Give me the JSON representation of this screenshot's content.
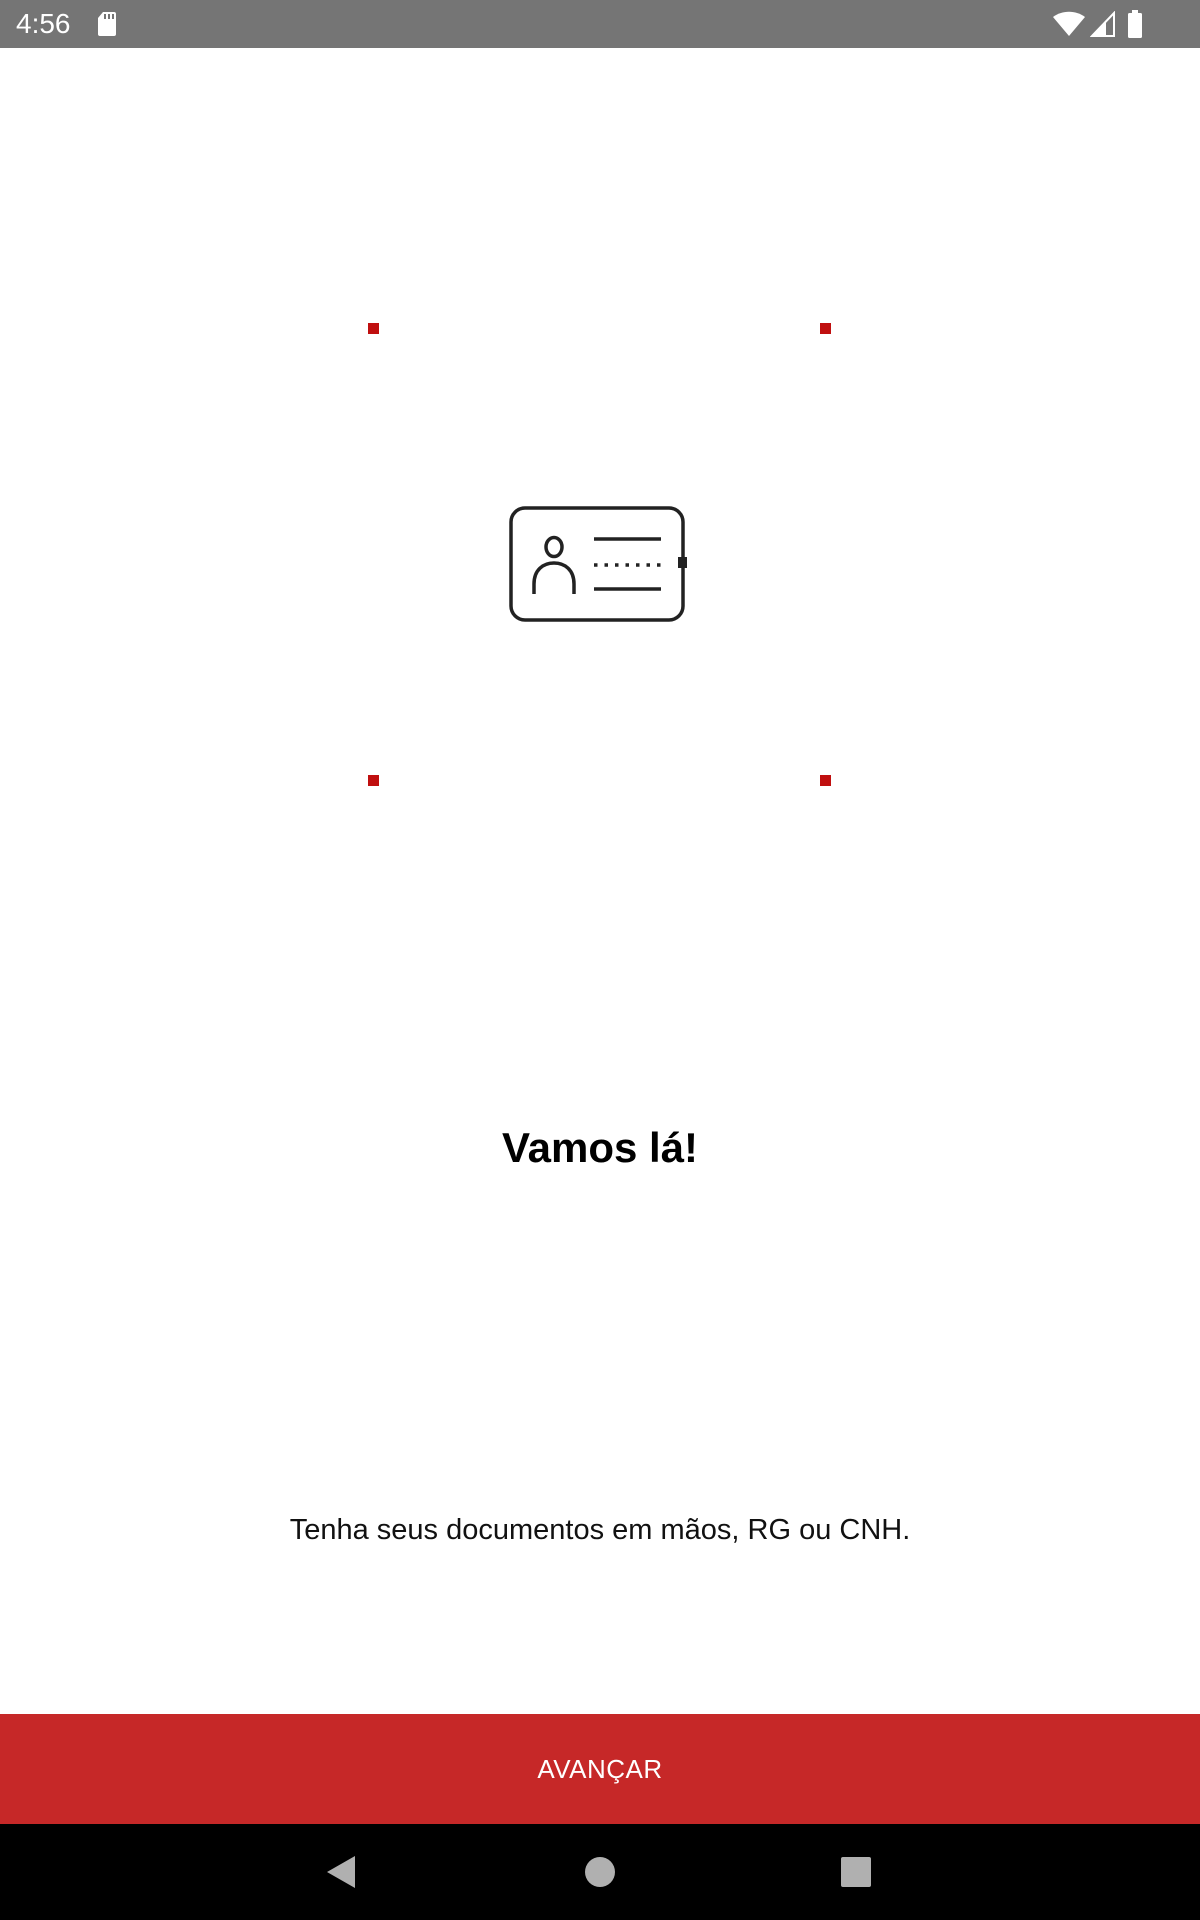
{
  "status_bar": {
    "time": "4:56",
    "icons": [
      "sd-card-icon",
      "wifi-icon",
      "signal-icon",
      "battery-icon"
    ]
  },
  "illustration": {
    "icon": "id-card-icon",
    "frame_color": "#c00f0f"
  },
  "content": {
    "title": "Vamos lá!",
    "subtitle": "Tenha seus documentos em mãos, RG ou CNH."
  },
  "actions": {
    "advance_label": "AVANÇAR",
    "button_color": "#c62828"
  },
  "nav_bar": {
    "icons": [
      "back-icon",
      "home-icon",
      "recents-icon"
    ]
  }
}
